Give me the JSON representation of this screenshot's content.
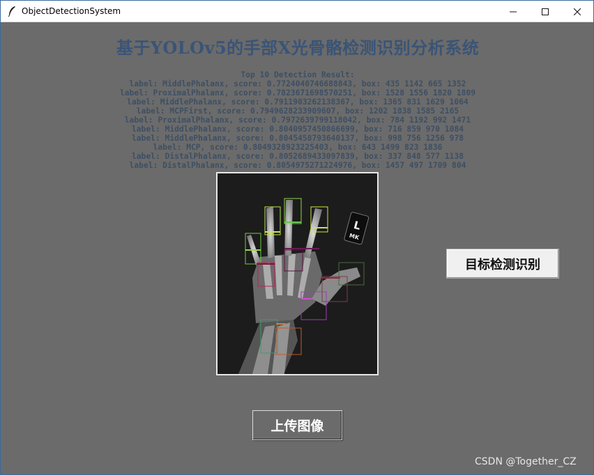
{
  "window": {
    "title": "ObjectDetectionSystem",
    "icon": "feather-icon",
    "controls": [
      "minimize-icon",
      "maximize-icon",
      "close-icon"
    ]
  },
  "app": {
    "title": "基于YOLOv5的手部X光骨骼检测识别分析系统"
  },
  "results": {
    "header": "Top 10 Detection Result:",
    "lines": [
      "label: MiddlePhalanx, score: 0.7724040746688843, box: 435 1142 665 1352",
      "label: ProximalPhalanx, score: 0.7823671698570251, box: 1528 1556 1820 1809",
      "label: MiddlePhalanx, score: 0.7911903262138367, box: 1365 831 1629 1064",
      "label: MCPFirst, score: 0.7949628233909607, box: 1202 1838 1585 2165",
      "label: ProximalPhalanx, score: 0.7972639799118042, box: 784 1192 992 1471",
      "label: MiddlePhalanx, score: 0.8040957450866699, box: 716 859 970 1084",
      "label: MiddlePhalanx, score: 0.8045458793640137, box: 998 756 1256 978",
      "label: MCP, score: 0.8049328923225403, box: 643 1499 823 1836",
      "label: DistalPhalanx, score: 0.8052689433097839, box: 337 848 577 1138",
      "label: DistalPhalanx, score: 0.8054975271224976, box: 1457 497 1709 804"
    ]
  },
  "image": {
    "marker_text": "L",
    "marker_subtext": "MK"
  },
  "buttons": {
    "detect": "目标检测识别",
    "upload": "上传图像"
  },
  "watermark": "CSDN @Together_CZ",
  "colors": {
    "background": "#6b6b6b",
    "title": "#3a5477",
    "result_text": "#3e4f63"
  }
}
